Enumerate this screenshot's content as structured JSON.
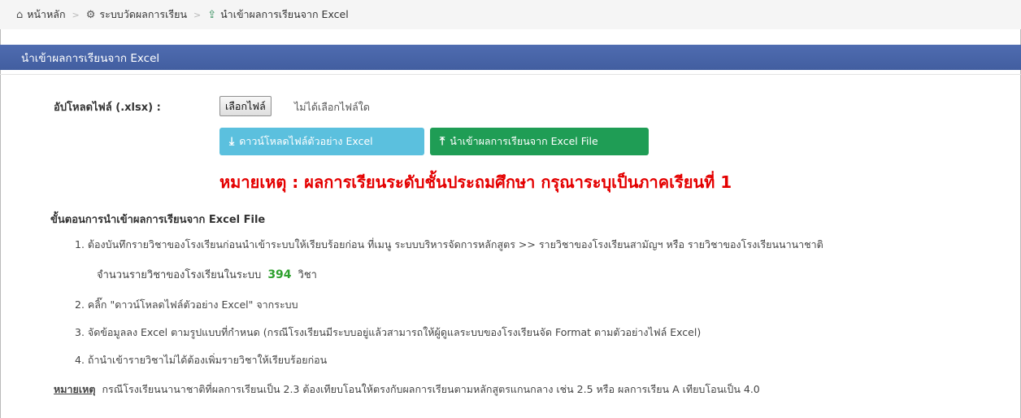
{
  "breadcrumb": {
    "home": {
      "icon": "home-icon",
      "label": "หน้าหลัก"
    },
    "evaluation": {
      "icon": "gears-icon",
      "label": "ระบบวัดผลการเรียน"
    },
    "current": {
      "icon": "upload-icon",
      "label": "นำเข้าผลการเรียนจาก Excel"
    }
  },
  "panel": {
    "title": "นำเข้าผลการเรียนจาก Excel"
  },
  "upload": {
    "label": "อัปโหลดไฟล์ (.xlsx) :",
    "choose_button": "เลือกไฟล์",
    "file_status": "ไม่ได้เลือกไฟล์ใด"
  },
  "buttons": {
    "download": {
      "icon": "download-icon",
      "label": "ดาวน์โหลดไฟล์ตัวอย่าง Excel"
    },
    "import": {
      "icon": "upload-icon",
      "label": "นำเข้าผลการเรียนจาก Excel File"
    }
  },
  "warning": "หมายเหตุ : ผลการเรียนระดับชั้นประถมศึกษา กรุณาระบุเป็นภาคเรียนที่ 1",
  "steps": {
    "title": "ขั้นตอนการนำเข้าผลการเรียนจาก Excel File",
    "items": [
      "1. ต้องบันทึกรายวิชาของโรงเรียนก่อนนำเข้าระบบให้เรียบร้อยก่อน ที่เมนู ระบบบริหารจัดการหลักสูตร >> รายวิชาของโรงเรียนสามัญฯ หรือ รายวิชาของโรงเรียนนานาชาติ",
      "2. คลิ๊ก \"ดาวน์โหลดไฟล์ตัวอย่าง Excel\" จากระบบ",
      "3. จัดข้อมูลลง Excel ตามรูปแบบที่กำหนด (กรณีโรงเรียนมีระบบอยู่แล้วสามารถให้ผู้ดูแลระบบของโรงเรียนจัด Format ตามตัวอย่างไฟล์ Excel)",
      "4. ถ้านำเข้ารายวิชาไม่ได้ต้องเพิ่มรายวิชาให้เรียบร้อยก่อน"
    ],
    "count_prefix": "จำนวนรายวิชาของโรงเรียนในระบบ",
    "count_value": "394",
    "count_suffix": "วิชา"
  },
  "note": {
    "label": "หมายเหตุ",
    "text": "กรณีโรงเรียนนานาชาติที่ผลการเรียนเป็น 2.3 ต้องเทียบโอนให้ตรงกับผลการเรียนตามหลักสูตรแกนกลาง เช่น 2.5 หรือ ผลการเรียน A เทียบโอนเป็น 4.0"
  },
  "colors": {
    "header": "#4a67ab",
    "download_button": "#5bc0de",
    "import_button": "#1f9d55",
    "warning": "#e40000",
    "count": "#2ea12e"
  }
}
